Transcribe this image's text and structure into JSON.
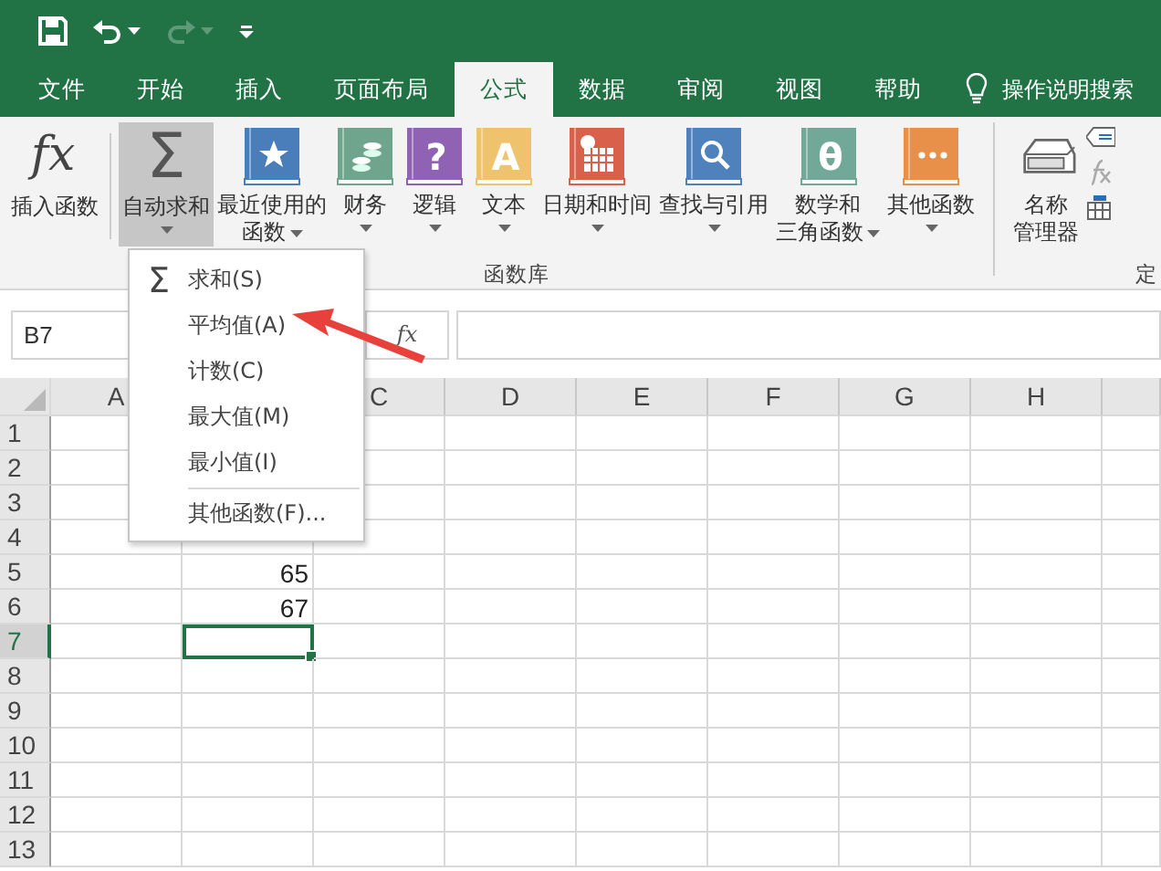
{
  "quick_access": [
    {
      "kind": "save",
      "disabled": false
    },
    {
      "kind": "undo",
      "disabled": false
    },
    {
      "kind": "redo",
      "disabled": true
    },
    {
      "kind": "customize",
      "disabled": false
    }
  ],
  "tabs": [
    {
      "label": "文件",
      "selected": false
    },
    {
      "label": "开始",
      "selected": false
    },
    {
      "label": "插入",
      "selected": false
    },
    {
      "label": "页面布局",
      "selected": false
    },
    {
      "label": "公式",
      "selected": true
    },
    {
      "label": "数据",
      "selected": false
    },
    {
      "label": "审阅",
      "selected": false
    },
    {
      "label": "视图",
      "selected": false
    },
    {
      "label": "帮助",
      "selected": false
    }
  ],
  "search": {
    "label": "操作说明搜索"
  },
  "ribbon": {
    "buttons": [
      {
        "kind": "fx",
        "glyph": "fx",
        "label": [
          "插入函数"
        ],
        "dropdown": false,
        "selected": false
      },
      {
        "kind": "sigma",
        "glyph": "Σ",
        "label": [
          "自动求和"
        ],
        "dropdown": true,
        "selected": true
      },
      {
        "kind": "star",
        "color": "#4a7ebb",
        "label": [
          "最近使用的",
          "函数"
        ],
        "dropdown": true,
        "selected": false
      },
      {
        "kind": "coins",
        "color": "#6fa58d",
        "label": [
          "财务"
        ],
        "dropdown": true,
        "selected": false
      },
      {
        "kind": "glyph",
        "color": "#9062b3",
        "glyph": "?",
        "label": [
          "逻辑"
        ],
        "dropdown": true,
        "selected": false
      },
      {
        "kind": "glyph",
        "color": "#efc26d",
        "glyph": "A",
        "label": [
          "文本"
        ],
        "dropdown": true,
        "selected": false
      },
      {
        "kind": "calendar",
        "color": "#d9604a",
        "label": [
          "日期和时间"
        ],
        "dropdown": true,
        "selected": false
      },
      {
        "kind": "search",
        "color": "#4f82bd",
        "label": [
          "查找与引用"
        ],
        "dropdown": true,
        "selected": false
      },
      {
        "kind": "glyph",
        "color": "#72a897",
        "glyph": "θ",
        "label": [
          "数学和",
          "三角函数"
        ],
        "dropdown": true,
        "selected": false
      },
      {
        "kind": "dots",
        "color": "#e8904a",
        "label": [
          "其他函数"
        ],
        "dropdown": true,
        "selected": false
      }
    ],
    "group_label": "函数库",
    "defined_names": {
      "label": [
        "名称",
        "管理器"
      ],
      "group_label": "定"
    }
  },
  "formula_bar": {
    "name_box": "B7",
    "function_button": "fx"
  },
  "sheet": {
    "columns": [
      {
        "label": "A"
      },
      {},
      {
        "label": "C"
      },
      {
        "label": "D"
      },
      {
        "label": "E"
      },
      {
        "label": "F"
      },
      {
        "label": "G"
      },
      {
        "label": "H"
      },
      {}
    ],
    "rows": [
      {
        "header": "1",
        "selected": false
      },
      {
        "header": "2",
        "selected": false
      },
      {
        "header": "3",
        "selected": false
      },
      {
        "header": "4",
        "selected": false
      },
      {
        "header": "5",
        "value": "65",
        "selected": false
      },
      {
        "header": "6",
        "value": "67",
        "selected": false
      },
      {
        "header": "7",
        "selected": true
      },
      {
        "header": "8",
        "selected": false
      },
      {
        "header": "9",
        "selected": false
      },
      {
        "header": "10",
        "selected": false
      },
      {
        "header": "11",
        "selected": false
      },
      {
        "header": "12",
        "selected": false
      },
      {
        "header": "13",
        "selected": false
      }
    ]
  },
  "menu": {
    "items": [
      {
        "glyph": "Σ",
        "label": "求和(S)",
        "separator_before": false
      },
      {
        "label": "平均值(A)",
        "separator_before": false
      },
      {
        "label": "计数(C)",
        "separator_before": false
      },
      {
        "label": "最大值(M)",
        "separator_before": false
      },
      {
        "label": "最小值(I)",
        "separator_before": false
      },
      {
        "label": "其他函数(F)...",
        "separator_before": true
      }
    ]
  },
  "annotations": [
    {
      "kind": "arrow"
    }
  ]
}
